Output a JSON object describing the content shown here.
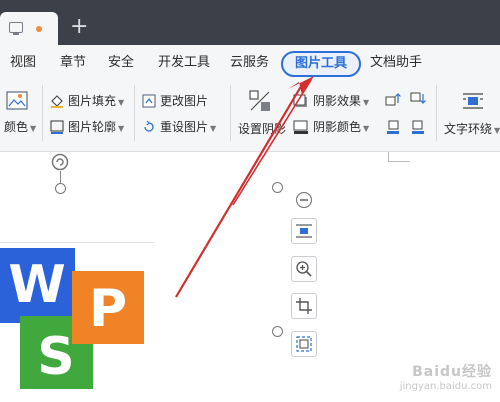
{
  "menubar": {
    "items": [
      {
        "label": "视图"
      },
      {
        "label": "章节"
      },
      {
        "label": "安全"
      },
      {
        "label": "开发工具"
      },
      {
        "label": "云服务"
      },
      {
        "label": "图片工具"
      },
      {
        "label": "文档助手"
      }
    ],
    "active": "图片工具"
  },
  "ribbon": {
    "color_label": "颜色",
    "fill_label": "图片填充",
    "outline_label": "图片轮廓",
    "change_label": "更改图片",
    "reset_label": "重设图片",
    "shadow_settings_label": "设置阴影",
    "shadow_effect_label": "阴影效果",
    "shadow_color_label": "阴影颜色",
    "text_wrap_label": "文字环绕"
  },
  "document": {
    "logo_letters": [
      "W",
      "P",
      "S"
    ]
  },
  "watermark": {
    "site": "Baidu经验",
    "url": "jingyan.baidu.com"
  },
  "colors": {
    "titlebar": "#3b4049",
    "accent": "#2f6fd6",
    "arrow": "#d22f2f",
    "logo_blue": "#2b62d9",
    "logo_orange": "#f08325",
    "logo_green": "#41a83d"
  }
}
